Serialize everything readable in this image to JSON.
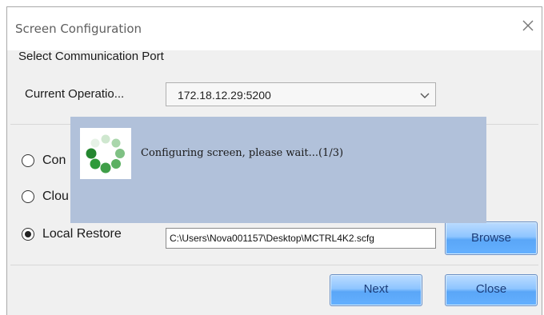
{
  "window": {
    "title": "Screen Configuration",
    "close_icon": "close-icon"
  },
  "section": {
    "label": "Select Communication Port"
  },
  "operation": {
    "label": "Current Operatio...",
    "selected": "172.18.12.29:5200"
  },
  "options": [
    {
      "label": "Con",
      "selected": false
    },
    {
      "label": "Clou",
      "selected": false
    },
    {
      "label": "Local Restore",
      "selected": true
    }
  ],
  "local_restore": {
    "path": "C:\\Users\\Nova001157\\Desktop\\MCTRL4K2.scfg",
    "browse_label": "Browse"
  },
  "progress": {
    "message": "Configuring screen, please wait...(1/3)",
    "spinner_icon": "loading-spinner-icon"
  },
  "footer": {
    "next_label": "Next",
    "close_label": "Close"
  },
  "colors": {
    "button_blue": "#5aa6f7",
    "overlay": "#b1c1da",
    "spinner_green": "#2e9a3a"
  }
}
